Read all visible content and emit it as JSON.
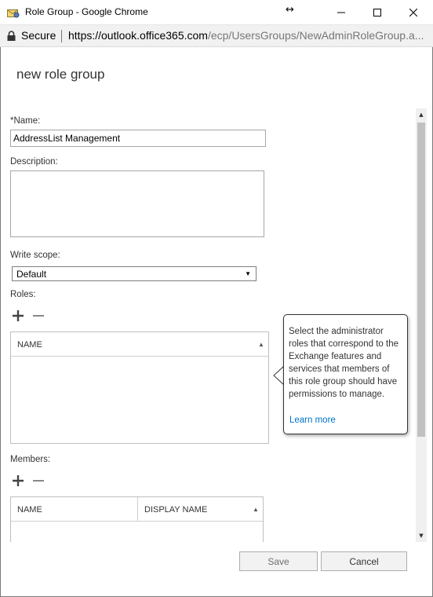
{
  "window": {
    "title": "Role Group - Google Chrome"
  },
  "address_bar": {
    "secure_label": "Secure",
    "url_host": "https://outlook.office365.com",
    "url_path": "/ecp/UsersGroups/NewAdminRoleGroup.a..."
  },
  "dialog": {
    "title": "new role group"
  },
  "form": {
    "name_label": "*Name:",
    "name_value": "AddressList Management",
    "description_label": "Description:",
    "description_value": "",
    "write_scope_label": "Write scope:",
    "write_scope_value": "Default",
    "roles_label": "Roles:",
    "roles_columns": [
      "NAME"
    ],
    "members_label": "Members:",
    "members_columns": [
      "NAME",
      "DISPLAY NAME"
    ]
  },
  "tooltip": {
    "text": "Select the administrator roles that correspond to the Exchange features and services that members of this role group should have permissions to manage.",
    "learn_more": "Learn more"
  },
  "buttons": {
    "save": "Save",
    "cancel": "Cancel"
  },
  "colors": {
    "link": "#0072c6",
    "border": "#a6a6a6",
    "button_bg": "#f2f2f2"
  }
}
